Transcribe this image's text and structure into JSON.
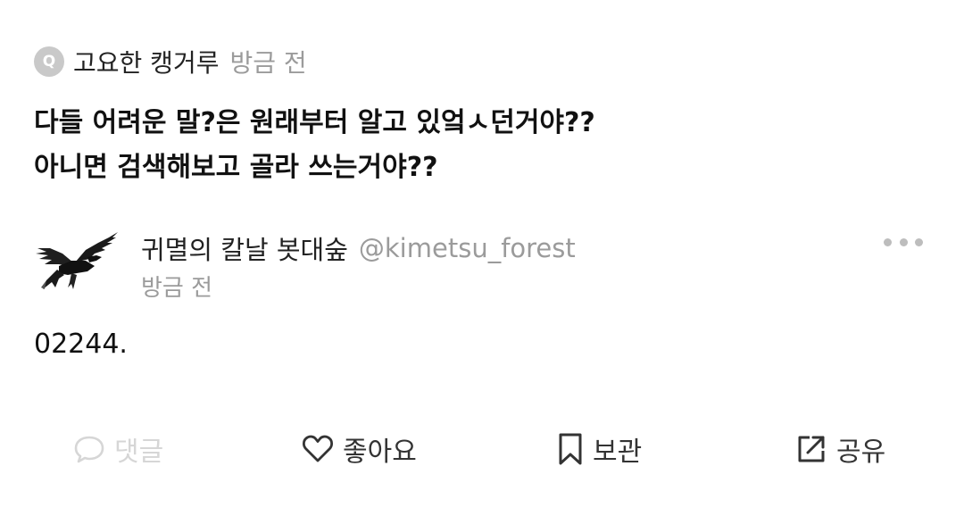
{
  "question": {
    "badge": "Q",
    "author": "고요한 캥거루",
    "time": "방금 전",
    "lines": [
      "다들 어려운 말?은 원래부터 알고 있엌ㅅ던거야??",
      "아니면 검색해보고 골라 쓰는거야??"
    ]
  },
  "answer": {
    "name": "귀멸의 칼날 봇대숲",
    "handle": "@kimetsu_forest",
    "time": "방금 전",
    "body": "02244.",
    "avatar_icon": "crow-icon"
  },
  "actions": {
    "comment": {
      "label": "댓글",
      "icon": "comment-icon",
      "enabled": false
    },
    "like": {
      "label": "좋아요",
      "icon": "heart-icon"
    },
    "save": {
      "label": "보관",
      "icon": "bookmark-icon"
    },
    "share": {
      "label": "공유",
      "icon": "share-icon"
    }
  },
  "colors": {
    "muted": "#9b9b9b",
    "text": "#111111",
    "disabled": "#d6d6d6"
  }
}
